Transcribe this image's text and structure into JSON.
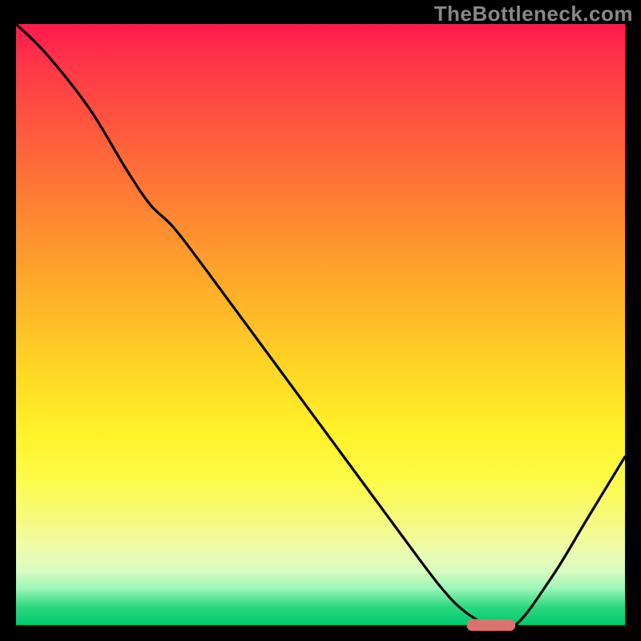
{
  "watermark": "TheBottleneck.com",
  "chart_data": {
    "type": "line",
    "title": "",
    "xlabel": "",
    "ylabel": "",
    "xlim": [
      0,
      100
    ],
    "ylim": [
      0,
      100
    ],
    "background_gradient": {
      "orientation": "vertical",
      "stops": [
        {
          "pos": 0.0,
          "color": "#ff1a4d"
        },
        {
          "pos": 0.5,
          "color": "#ffd826"
        },
        {
          "pos": 0.9,
          "color": "#efffa8"
        },
        {
          "pos": 1.0,
          "color": "#00c96c"
        }
      ]
    },
    "series": [
      {
        "name": "bottleneck-curve",
        "x": [
          0,
          5,
          12,
          18,
          22,
          26,
          32,
          40,
          48,
          56,
          64,
          70,
          74,
          78,
          82,
          88,
          94,
          100
        ],
        "y": [
          100,
          95,
          86,
          76,
          70,
          66,
          58,
          47,
          36,
          25,
          14,
          6,
          2,
          0,
          0,
          8,
          18,
          28
        ]
      }
    ],
    "marker": {
      "name": "highlight-segment",
      "x_start": 74,
      "x_end": 82,
      "y": 0,
      "color": "#d8736e",
      "shape": "rounded-bar"
    },
    "grid": false,
    "legend": false
  }
}
